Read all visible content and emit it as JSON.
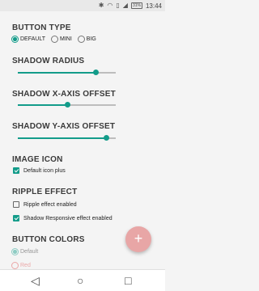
{
  "status_bar": {
    "icons": [
      "bluetooth-icon",
      "wifi-icon",
      "cellular-icon",
      "signal-icon",
      "battery-icon"
    ],
    "battery": "31%",
    "time": "13:44"
  },
  "button_type": {
    "title": "BUTTON TYPE",
    "options": [
      "DEFAULT",
      "MINI",
      "BIG"
    ],
    "selected": "DEFAULT"
  },
  "shadow_radius": {
    "title": "SHADOW RADIUS",
    "value": 0.79
  },
  "shadow_x": {
    "title": "SHADOW X-AXIS OFFSET",
    "value": 0.5
  },
  "shadow_y": {
    "title": "SHADOW Y-AXIS OFFSET",
    "value": 0.9
  },
  "image_icon": {
    "title": "IMAGE ICON",
    "option": {
      "label": "Default icon plus",
      "checked": true
    }
  },
  "ripple_effect": {
    "title": "RIPPLE EFFECT",
    "options": [
      {
        "label": "Ripple effect enabled",
        "checked": false
      },
      {
        "label": "Shadow Responsive effect enabled",
        "checked": true
      }
    ]
  },
  "button_colors": {
    "title": "BUTTON COLORS",
    "options": [
      "Default",
      "Red"
    ],
    "selected": "Default"
  },
  "fab": {
    "symbol": "+"
  },
  "nav": {
    "back": "◁",
    "home": "○",
    "recents": "□"
  },
  "colors": {
    "accent": "#139c8a",
    "fab": "#e8a6a6",
    "red_option": "#e57373"
  }
}
